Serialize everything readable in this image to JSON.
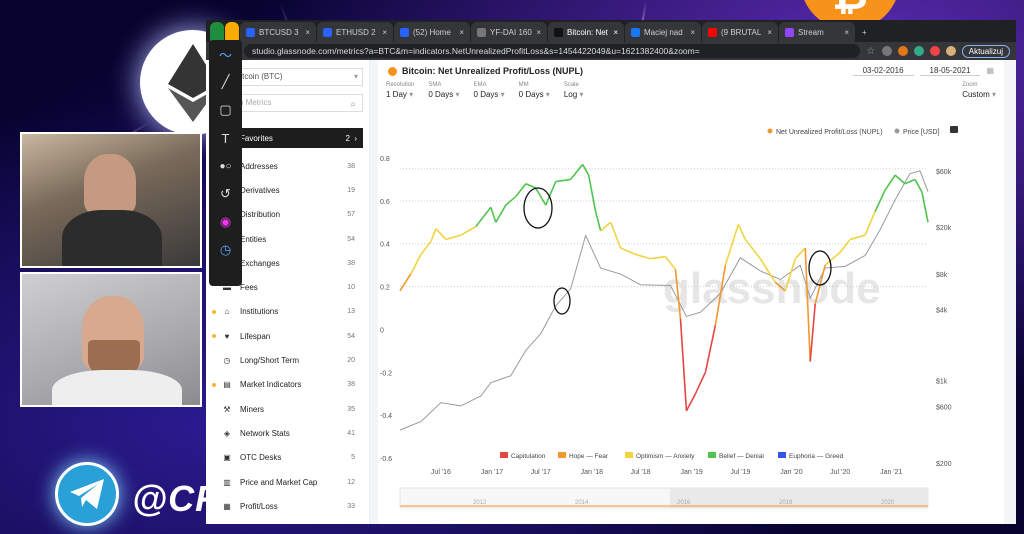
{
  "overlay": {
    "handle": "@CRY"
  },
  "browser": {
    "tabs": [
      {
        "label": "BTCUSD 3",
        "color": "#2962ff"
      },
      {
        "label": "ETHUSD 2",
        "color": "#2962ff"
      },
      {
        "label": "(52) Home",
        "color": "#2962ff"
      },
      {
        "label": "YF-DAI 160",
        "color": "#777777"
      },
      {
        "label": "Bitcoin: Net",
        "color": "#111111",
        "active": true
      },
      {
        "label": "Maciej nad",
        "color": "#1877f2"
      },
      {
        "label": "(9 BRUTAL",
        "color": "#ff0000"
      },
      {
        "label": "Stream",
        "color": "#9146ff"
      }
    ],
    "url": "studio.glassnode.com/metrics?a=BTC&m=indicators.NetUnrealizedProfitLoss&s=1454422049&u=1621382400&zoom=",
    "update_label": "Aktualizuj"
  },
  "sidebar": {
    "asset": "Bitcoin (BTC)",
    "search_placeholder": "ch Metrics",
    "favorites": {
      "label": "Favorites",
      "count": "2"
    },
    "categories": [
      {
        "icon": "addresses-icon",
        "glyph": "◉",
        "label": "Addresses",
        "count": "38",
        "dot": false
      },
      {
        "icon": "derivatives-icon",
        "glyph": "⟳",
        "label": "Derivatives",
        "count": "19",
        "dot": false
      },
      {
        "icon": "distribution-icon",
        "glyph": "◔",
        "label": "Distribution",
        "count": "57",
        "dot": false
      },
      {
        "icon": "entities-icon",
        "glyph": "◎",
        "label": "Entities",
        "count": "54",
        "dot": false
      },
      {
        "icon": "exchanges-icon",
        "glyph": "⇄",
        "label": "Exchanges",
        "count": "38",
        "dot": false
      },
      {
        "icon": "fees-icon",
        "glyph": "▬",
        "label": "Fees",
        "count": "10",
        "dot": false
      },
      {
        "icon": "institutions-icon",
        "glyph": "⌂",
        "label": "Institutions",
        "count": "13",
        "dot": true
      },
      {
        "icon": "lifespan-icon",
        "glyph": "♥",
        "label": "Lifespan",
        "count": "54",
        "dot": true
      },
      {
        "icon": "long-short-term-icon",
        "glyph": "◷",
        "label": "Long/Short Term",
        "count": "20",
        "dot": false
      },
      {
        "icon": "market-indicators-icon",
        "glyph": "▤",
        "label": "Market Indicators",
        "count": "38",
        "dot": true
      },
      {
        "icon": "miners-icon",
        "glyph": "⚒",
        "label": "Miners",
        "count": "35",
        "dot": false
      },
      {
        "icon": "network-stats-icon",
        "glyph": "◈",
        "label": "Network Stats",
        "count": "41",
        "dot": false
      },
      {
        "icon": "otc-desks-icon",
        "glyph": "▣",
        "label": "OTC Desks",
        "count": "5",
        "dot": false
      },
      {
        "icon": "price-market-cap-icon",
        "glyph": "▥",
        "label": "Price and Market Cap",
        "count": "12",
        "dot": false
      },
      {
        "icon": "profit-loss-icon",
        "glyph": "▦",
        "label": "Profit/Loss",
        "count": "33",
        "dot": false
      }
    ]
  },
  "card": {
    "title": "Bitcoin: Net Unrealized Profit/Loss (NUPL)",
    "date_from": "03-02-2016",
    "date_to": "18-05-2021",
    "controls": [
      {
        "label": "Resolution",
        "value": "1 Day"
      },
      {
        "label": "SMA",
        "value": "0 Days"
      },
      {
        "label": "EMA",
        "value": "0 Days"
      },
      {
        "label": "MM",
        "value": "0 Days"
      },
      {
        "label": "Scale",
        "value": "Log"
      }
    ],
    "zoom": {
      "label": "Zoom",
      "value": "Custom"
    }
  },
  "chart_data": {
    "type": "line",
    "title": "",
    "legend_top": [
      "Net Unrealized Profit/Loss (NUPL)",
      "Price [USD]"
    ],
    "legend_bottom": [
      "Capitulation",
      "Hope — Fear",
      "Optimism — Anxiety",
      "Belief — Denial",
      "Euphoria — Greed"
    ],
    "colors": {
      "capitulation": "#e64545",
      "hope_fear": "#f2962f",
      "optimism_anxiety": "#f0d440",
      "belief_denial": "#4fc44f",
      "euphoria_greed": "#3355ee",
      "price": "#9a9a9a"
    },
    "x_ticks": [
      "Jul '16",
      "Jan '17",
      "Jul '17",
      "Jan '18",
      "Jul '18",
      "Jan '19",
      "Jul '19",
      "Jan '20",
      "Jul '20",
      "Jan '21"
    ],
    "y_left_ticks": [
      "0.8",
      "0.6",
      "0.4",
      "0.2",
      "0",
      "-0.2",
      "-0.4",
      "-0.6"
    ],
    "y_right_ticks": [
      "$60k",
      "$20k",
      "$8k",
      "$4k",
      "$1k",
      "$600",
      "$200"
    ],
    "ylim": [
      -0.6,
      0.8
    ],
    "watermark": "glassnode",
    "navigator_years": [
      "2012",
      "2014",
      "2016",
      "2018",
      "2020"
    ],
    "nupl": [
      [
        2016.09,
        0.18
      ],
      [
        2016.2,
        0.26
      ],
      [
        2016.3,
        0.35
      ],
      [
        2016.4,
        0.41
      ],
      [
        2016.45,
        0.47
      ],
      [
        2016.55,
        0.42
      ],
      [
        2016.7,
        0.44
      ],
      [
        2016.85,
        0.48
      ],
      [
        2017.0,
        0.57
      ],
      [
        2017.05,
        0.5
      ],
      [
        2017.15,
        0.58
      ],
      [
        2017.25,
        0.62
      ],
      [
        2017.35,
        0.68
      ],
      [
        2017.45,
        0.66
      ],
      [
        2017.55,
        0.58
      ],
      [
        2017.65,
        0.69
      ],
      [
        2017.8,
        0.7
      ],
      [
        2017.92,
        0.77
      ],
      [
        2017.98,
        0.72
      ],
      [
        2018.05,
        0.55
      ],
      [
        2018.1,
        0.46
      ],
      [
        2018.2,
        0.5
      ],
      [
        2018.3,
        0.38
      ],
      [
        2018.45,
        0.35
      ],
      [
        2018.6,
        0.33
      ],
      [
        2018.75,
        0.34
      ],
      [
        2018.85,
        0.28
      ],
      [
        2018.9,
        0.05
      ],
      [
        2018.96,
        -0.38
      ],
      [
        2019.05,
        -0.3
      ],
      [
        2019.15,
        -0.2
      ],
      [
        2019.25,
        0.02
      ],
      [
        2019.35,
        0.3
      ],
      [
        2019.48,
        0.49
      ],
      [
        2019.55,
        0.42
      ],
      [
        2019.7,
        0.33
      ],
      [
        2019.85,
        0.22
      ],
      [
        2019.95,
        0.18
      ],
      [
        2020.05,
        0.33
      ],
      [
        2020.15,
        0.38
      ],
      [
        2020.2,
        -0.15
      ],
      [
        2020.25,
        0.12
      ],
      [
        2020.35,
        0.3
      ],
      [
        2020.5,
        0.36
      ],
      [
        2020.6,
        0.42
      ],
      [
        2020.75,
        0.44
      ],
      [
        2020.85,
        0.55
      ],
      [
        2020.95,
        0.65
      ],
      [
        2021.05,
        0.72
      ],
      [
        2021.15,
        0.68
      ],
      [
        2021.25,
        0.7
      ],
      [
        2021.32,
        0.64
      ],
      [
        2021.38,
        0.5
      ]
    ],
    "price": [
      [
        2016.09,
        380
      ],
      [
        2016.3,
        450
      ],
      [
        2016.5,
        650
      ],
      [
        2016.7,
        610
      ],
      [
        2016.9,
        740
      ],
      [
        2017.0,
        960
      ],
      [
        2017.2,
        1100
      ],
      [
        2017.35,
        1800
      ],
      [
        2017.5,
        2500
      ],
      [
        2017.65,
        4300
      ],
      [
        2017.8,
        6000
      ],
      [
        2017.95,
        17000
      ],
      [
        2018.1,
        9000
      ],
      [
        2018.3,
        8000
      ],
      [
        2018.5,
        6500
      ],
      [
        2018.8,
        6400
      ],
      [
        2018.96,
        3500
      ],
      [
        2019.1,
        3800
      ],
      [
        2019.3,
        5500
      ],
      [
        2019.5,
        11000
      ],
      [
        2019.7,
        8500
      ],
      [
        2019.9,
        7200
      ],
      [
        2020.1,
        9500
      ],
      [
        2020.2,
        5000
      ],
      [
        2020.35,
        9000
      ],
      [
        2020.55,
        9300
      ],
      [
        2020.75,
        11500
      ],
      [
        2020.9,
        19000
      ],
      [
        2021.05,
        34000
      ],
      [
        2021.2,
        57000
      ],
      [
        2021.3,
        60000
      ],
      [
        2021.38,
        40000
      ]
    ]
  }
}
